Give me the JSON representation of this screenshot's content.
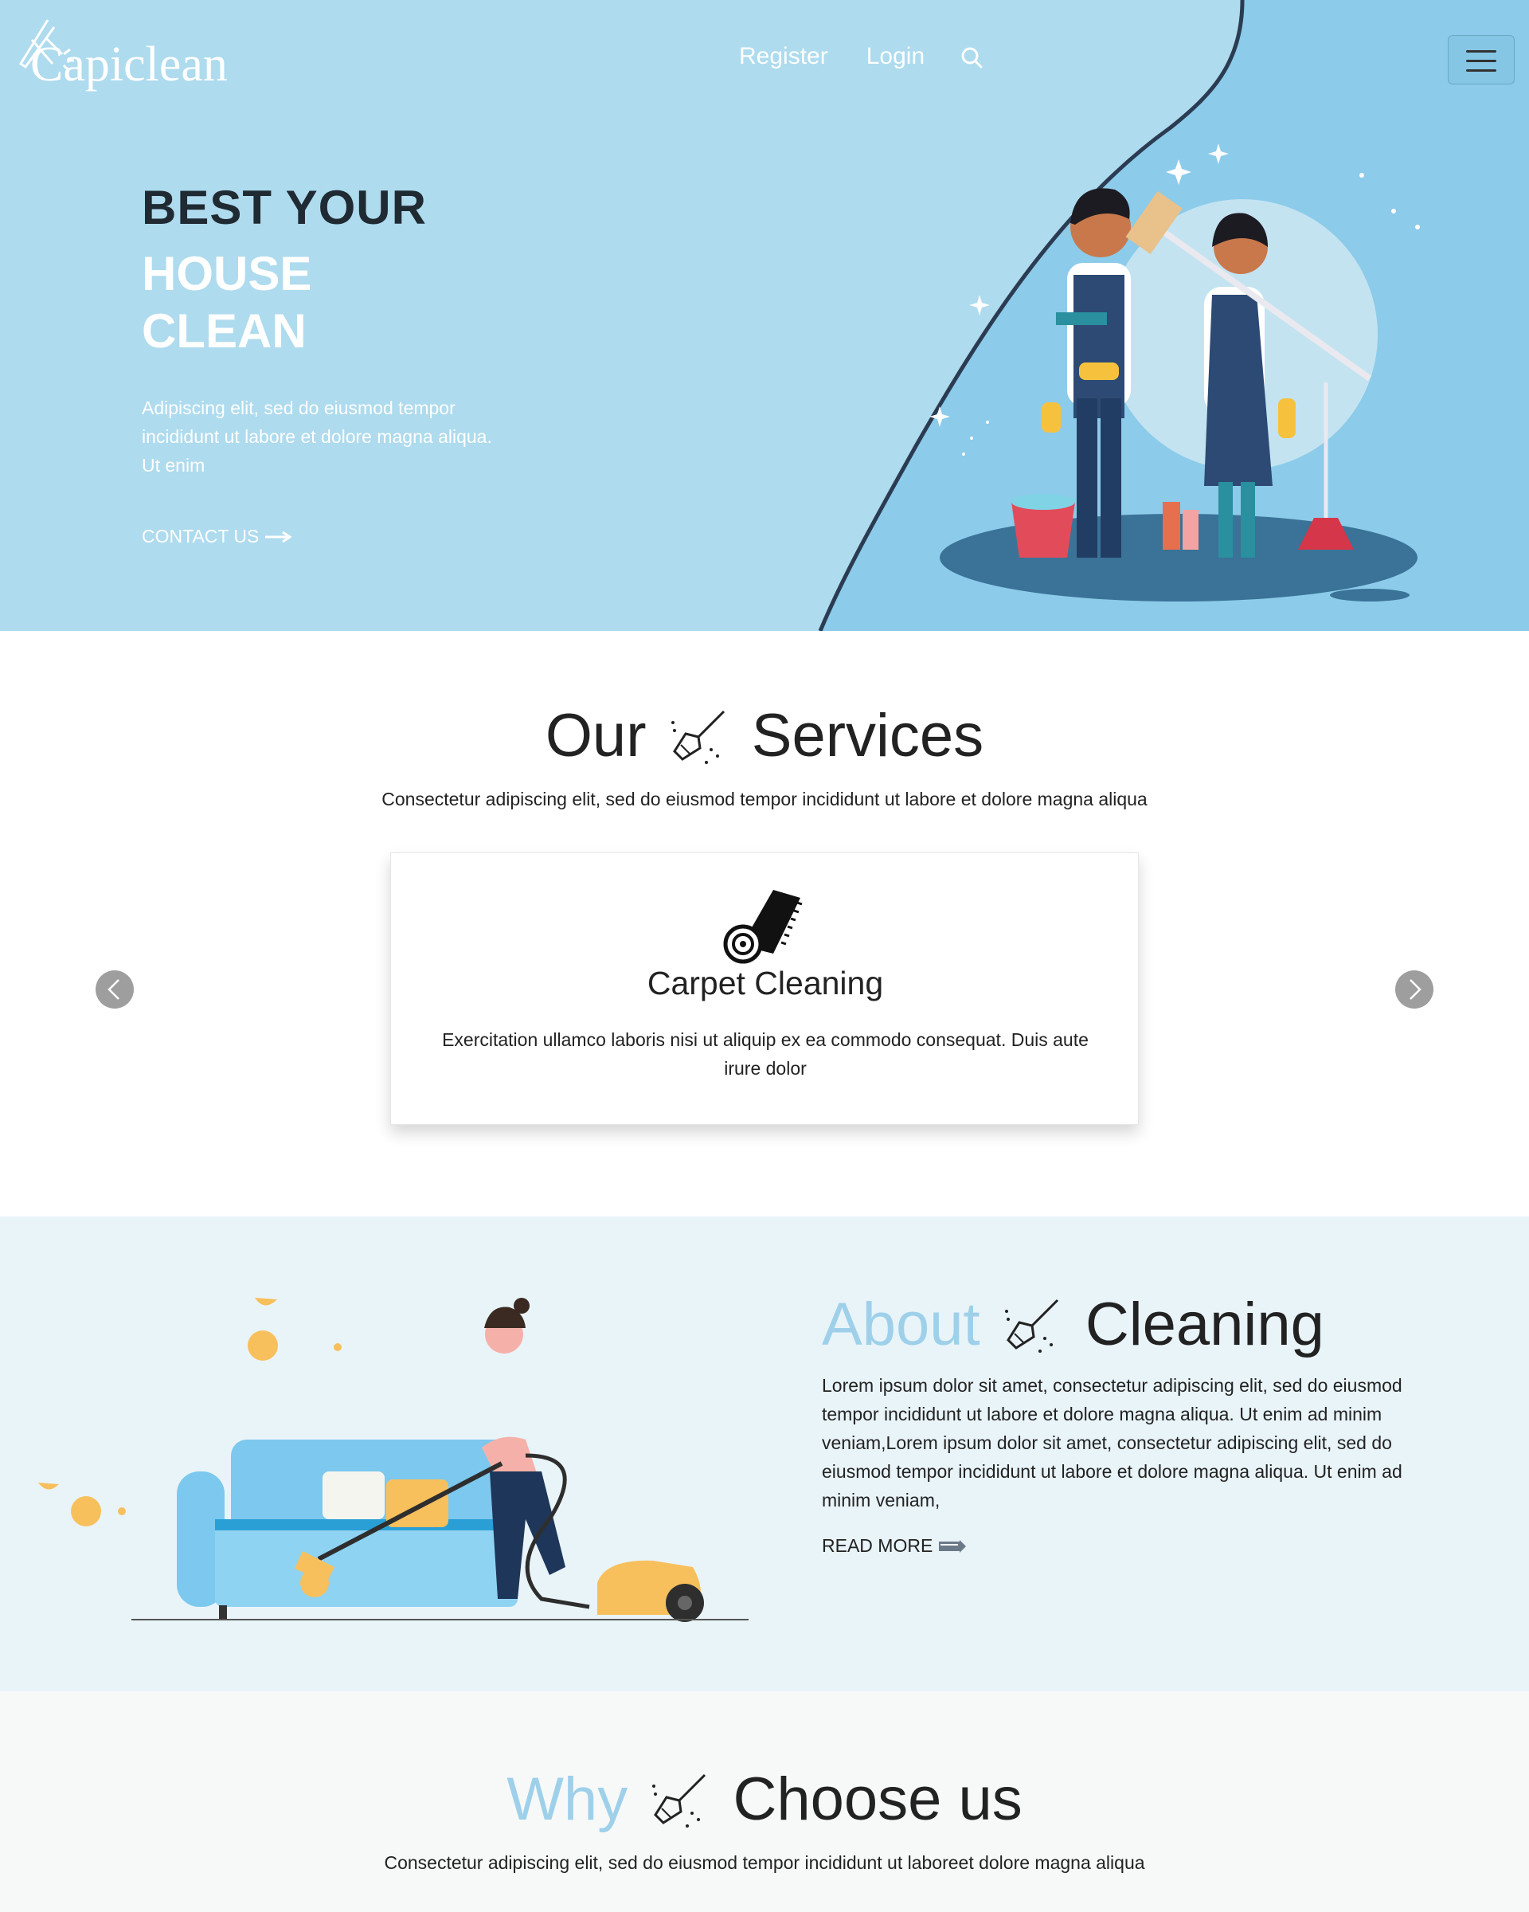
{
  "header": {
    "logo_text": "Capiclean",
    "nav": {
      "register": "Register",
      "login": "Login"
    },
    "search_icon": "search-icon",
    "menu_icon": "hamburger-menu-icon"
  },
  "hero": {
    "title_line1": "BEST YOUR",
    "title_line2": "HOUSE",
    "title_line3": "CLEAN",
    "text": "Adipiscing elit, sed do eiusmod tempor incididunt ut labore et dolore magna aliqua. Ut enim",
    "contact_label": "CONTACT US"
  },
  "services": {
    "title_left": "Our",
    "title_right": "Services",
    "subtitle": "Consectetur adipiscing elit, sed do eiusmod tempor incididunt ut labore et dolore magna aliqua",
    "card": {
      "icon": "carpet-roll-icon",
      "title": "Carpet Cleaning",
      "text": "Exercitation ullamco laboris nisi ut aliquip ex ea commodo consequat. Duis aute irure dolor"
    }
  },
  "about": {
    "title_accent": "About",
    "title_right": "Cleaning",
    "text": "Lorem ipsum dolor sit amet, consectetur adipiscing elit, sed do eiusmod tempor incididunt ut labore et dolore magna aliqua. Ut enim ad minim veniam,Lorem ipsum dolor sit amet, consectetur adipiscing elit, sed do eiusmod tempor incididunt ut labore et dolore magna aliqua. Ut enim ad minim veniam,",
    "read_more": "READ MORE"
  },
  "why": {
    "title_accent": "Why",
    "title_right": "Choose us",
    "subtitle": "Consectetur adipiscing elit, sed do eiusmod tempor incididunt ut laboreet dolore magna aliqua"
  },
  "colors": {
    "hero_bg": "#aedbee",
    "hero_shape": "#8ccbea",
    "accent": "#9fd0ea",
    "about_bg": "#e9f4f9",
    "why_bg": "#f7f9f9"
  }
}
